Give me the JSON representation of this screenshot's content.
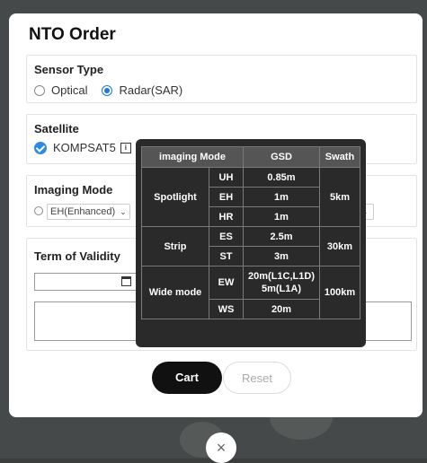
{
  "modal": {
    "title": "NTO Order",
    "sensor_type": {
      "label": "Sensor Type",
      "options": [
        {
          "label": "Optical",
          "selected": false
        },
        {
          "label": "Radar(SAR)",
          "selected": true
        }
      ]
    },
    "satellite": {
      "label": "Satellite",
      "name": "KOMPSAT5",
      "checked": true,
      "info_icon": "info-icon"
    },
    "imaging_mode": {
      "label": "Imaging Mode",
      "selected": "EH(Enhanced)"
    },
    "term_of_validity": {
      "label": "Term of Validity",
      "date_value": "",
      "note_value": ""
    },
    "buttons": {
      "cart": "Cart",
      "reset": "Reset"
    },
    "close_symbol": "×"
  },
  "tooltip": {
    "headers": [
      "imaging Mode",
      "GSD",
      "Swath"
    ],
    "groups": [
      {
        "mode": "Spotlight",
        "swath": "5km",
        "rows": [
          {
            "code": "UH",
            "gsd": "0.85m"
          },
          {
            "code": "EH",
            "gsd": "1m"
          },
          {
            "code": "HR",
            "gsd": "1m"
          }
        ]
      },
      {
        "mode": "Strip",
        "swath": "30km",
        "rows": [
          {
            "code": "ES",
            "gsd": "2.5m"
          },
          {
            "code": "ST",
            "gsd": "3m"
          }
        ]
      },
      {
        "mode": "Wide mode",
        "swath": "100km",
        "rows": [
          {
            "code": "EW",
            "gsd": "20m(L1C,L1D)\n5m(L1A)"
          },
          {
            "code": "WS",
            "gsd": "20m"
          }
        ]
      }
    ]
  },
  "colors": {
    "accent": "#1a7ad9",
    "backdrop": "#46494a",
    "tooltip_bg": "#2a2a2a"
  }
}
